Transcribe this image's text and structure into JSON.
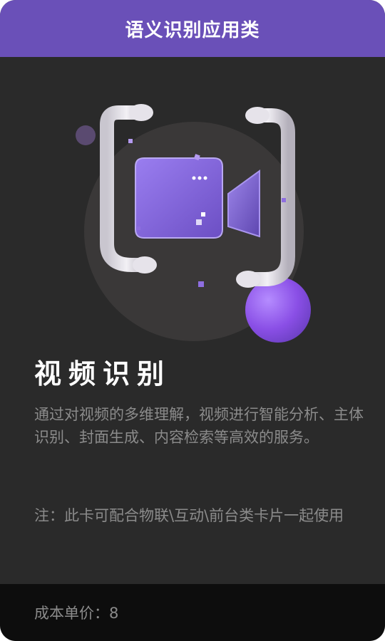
{
  "header": {
    "title": "语义识别应用类"
  },
  "card": {
    "title": "视频识别",
    "description": "通过对视频的多维理解，视频进行智能分析、主体识别、封面生成、内容检索等高效的服务。",
    "note": "注：此卡可配合物联\\互动\\前台类卡片一起使用"
  },
  "footer": {
    "price_label": "成本单价：",
    "price_value": "8"
  },
  "colors": {
    "header_bg": "#6a50b8",
    "card_bg": "#2a2a2a",
    "footer_bg": "#0d0d0d",
    "accent_purple": "#8a63e0"
  },
  "illustration": {
    "icon": "video-camera-icon",
    "bracket_icon": "scan-bracket-icon"
  }
}
